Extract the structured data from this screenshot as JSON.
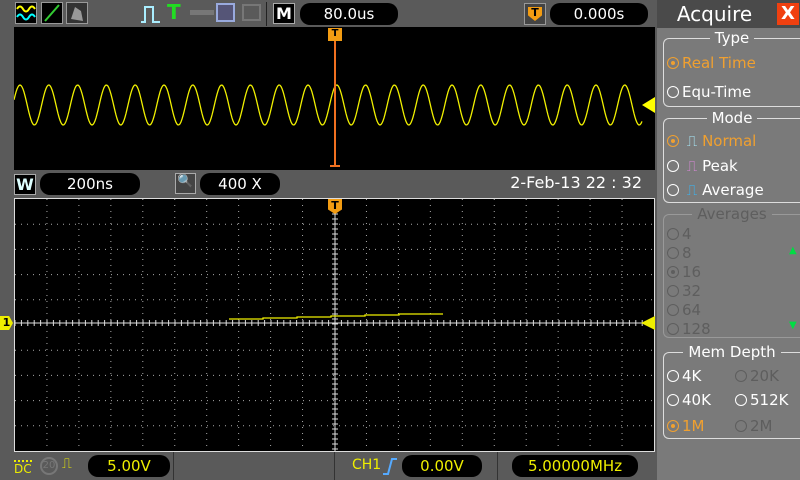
{
  "toolbar": {
    "timebase": "80.0us",
    "trigger_position": "0.000s",
    "math_label": "M",
    "trigger_label": "T"
  },
  "overview": {
    "trigger_marker": "T"
  },
  "zoom_bar": {
    "window_label": "W",
    "window_timebase": "200ns",
    "zoom_factor": "400 X",
    "datetime": "2-Feb-13 22 : 32"
  },
  "main": {
    "trigger_marker": "T",
    "channel_marker": "1"
  },
  "bottom": {
    "coupling": "DC",
    "bw_limit": "20",
    "ch1_scale": "5.00V",
    "trigger_source": "CH1",
    "trigger_level": "0.00V",
    "frequency": "5.00000MHz"
  },
  "panel": {
    "title": "Acquire",
    "close": "X",
    "type": {
      "label": "Type",
      "options": [
        {
          "label": "Real Time",
          "selected": true
        },
        {
          "label": "Equ-Time",
          "selected": false
        }
      ]
    },
    "mode": {
      "label": "Mode",
      "options": [
        {
          "label": "Normal",
          "selected": true
        },
        {
          "label": "Peak",
          "selected": false
        },
        {
          "label": "Average",
          "selected": false
        }
      ]
    },
    "averages": {
      "label": "Averages",
      "options": [
        "4",
        "8",
        "16",
        "32",
        "64",
        "128"
      ],
      "selected": "16"
    },
    "mem_depth": {
      "label": "Mem Depth",
      "options": [
        "4K",
        "20K",
        "40K",
        "512K",
        "1M",
        "2M"
      ],
      "selected": "1M"
    }
  },
  "colors": {
    "ch1": "#f0f000",
    "trigger": "#f08000",
    "accent": "#f0a030"
  }
}
